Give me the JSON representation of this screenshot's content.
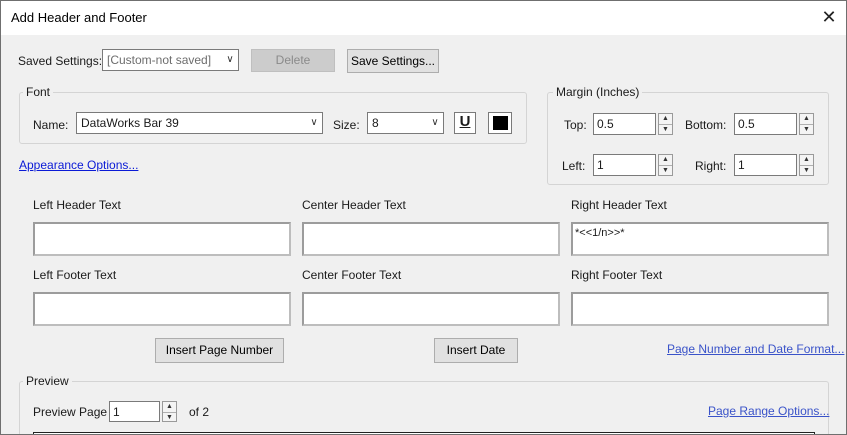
{
  "window": {
    "title": "Add Header and Footer",
    "close_glyph": "✕"
  },
  "saved_settings": {
    "label": "Saved Settings:",
    "value": "[Custom-not saved]",
    "delete_label": "Delete",
    "save_label": "Save Settings..."
  },
  "font": {
    "group_title": "Font",
    "name_label": "Name:",
    "name_value": "DataWorks Bar 39",
    "size_label": "Size:",
    "size_value": "8",
    "underline_glyph": "U",
    "text_color": "#000000"
  },
  "appearance_link": "Appearance Options...",
  "margin": {
    "group_title": "Margin (Inches)",
    "top_label": "Top:",
    "top_value": "0.5",
    "bottom_label": "Bottom:",
    "bottom_value": "0.5",
    "left_label": "Left:",
    "left_value": "1",
    "right_label": "Right:",
    "right_value": "1"
  },
  "header_footer": {
    "left_header_label": "Left Header Text",
    "center_header_label": "Center Header Text",
    "right_header_label": "Right Header Text",
    "left_header_value": "",
    "center_header_value": "",
    "right_header_value": "*<<1/n>>*",
    "left_footer_label": "Left Footer Text",
    "center_footer_label": "Center Footer Text",
    "right_footer_label": "Right Footer Text",
    "left_footer_value": "",
    "center_footer_value": "",
    "right_footer_value": ""
  },
  "actions": {
    "insert_page_number": "Insert Page Number",
    "insert_date": "Insert Date",
    "page_number_date_format": "Page Number and Date Format..."
  },
  "preview": {
    "group_title": "Preview",
    "page_label": "Preview Page",
    "page_value": "1",
    "of_label": "of 2",
    "page_range_link": "Page Range Options..."
  }
}
